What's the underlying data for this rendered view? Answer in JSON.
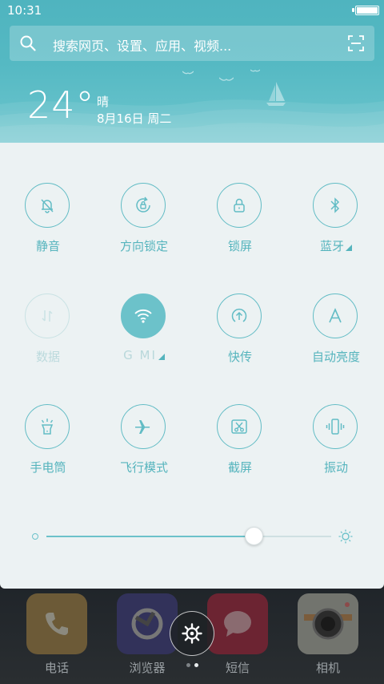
{
  "status_bar": {
    "time": "10:31"
  },
  "search": {
    "placeholder": "搜索网页、设置、应用、视频..."
  },
  "weather": {
    "temperature": "24°",
    "condition": "晴",
    "date": "8月16日 周二"
  },
  "toggles": [
    {
      "label": "静音",
      "icon": "bell-off-icon",
      "state": "off"
    },
    {
      "label": "方向锁定",
      "icon": "rotation-lock-icon",
      "state": "off"
    },
    {
      "label": "锁屏",
      "icon": "lock-icon",
      "state": "off"
    },
    {
      "label": "蓝牙",
      "icon": "bluetooth-icon",
      "state": "off",
      "has_menu": true
    },
    {
      "label": "数据",
      "icon": "mobile-data-icon",
      "state": "disabled"
    },
    {
      "label": "G MI",
      "icon": "wifi-icon",
      "state": "on",
      "has_menu": true
    },
    {
      "label": "快传",
      "icon": "quick-transfer-icon",
      "state": "off"
    },
    {
      "label": "自动亮度",
      "icon": "auto-brightness-icon",
      "state": "off"
    },
    {
      "label": "手电筒",
      "icon": "flashlight-icon",
      "state": "off"
    },
    {
      "label": "飞行模式",
      "icon": "airplane-icon",
      "state": "off"
    },
    {
      "label": "截屏",
      "icon": "screenshot-icon",
      "state": "off"
    },
    {
      "label": "振动",
      "icon": "vibrate-icon",
      "state": "off"
    }
  ],
  "brightness": {
    "level": 0.73
  },
  "dock": [
    {
      "label": "电话",
      "icon": "phone-icon"
    },
    {
      "label": "浏览器",
      "icon": "browser-icon"
    },
    {
      "label": "短信",
      "icon": "message-icon"
    },
    {
      "label": "相机",
      "icon": "camera-icon"
    }
  ],
  "page_indicator": {
    "pages": 2,
    "current": 2
  },
  "colors": {
    "accent": "#62bcc5",
    "header": "#55b9c3",
    "panel_bg": "#ecf2f3",
    "active_toggle": "#6cc2ca"
  }
}
